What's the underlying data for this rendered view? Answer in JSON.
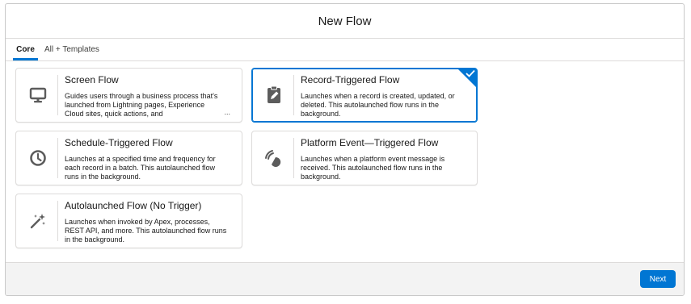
{
  "modal": {
    "title": "New Flow"
  },
  "tabs": [
    {
      "label": "Core",
      "active": true
    },
    {
      "label": "All + Templates",
      "active": false
    }
  ],
  "cards": [
    {
      "title": "Screen Flow",
      "description": "Guides users through a business process that's launched from Lightning pages, Experience Cloud sites, quick actions, and",
      "more": "...",
      "icon": "monitor-icon",
      "selected": false
    },
    {
      "title": "Record-Triggered Flow",
      "description": "Launches when a record is created, updated, or deleted. This autolaunched flow runs in the background.",
      "icon": "clipboard-edit-icon",
      "selected": true
    },
    {
      "title": "Schedule-Triggered Flow",
      "description": "Launches at a specified time and frequency for each record in a batch. This autolaunched flow runs in the background.",
      "icon": "clock-icon",
      "selected": false
    },
    {
      "title": "Platform Event—Triggered Flow",
      "description": "Launches when a platform event message is received. This autolaunched flow runs in the background.",
      "icon": "signal-icon",
      "selected": false
    },
    {
      "title": "Autolaunched Flow (No Trigger)",
      "description": "Launches when invoked by Apex, processes, REST API, and more. This autolaunched flow runs in the background.",
      "icon": "magic-wand-icon",
      "selected": false
    }
  ],
  "footer": {
    "next_label": "Next"
  },
  "colors": {
    "brand": "#0176d3",
    "icon": "#5c5c5c",
    "border": "#dddbda"
  }
}
